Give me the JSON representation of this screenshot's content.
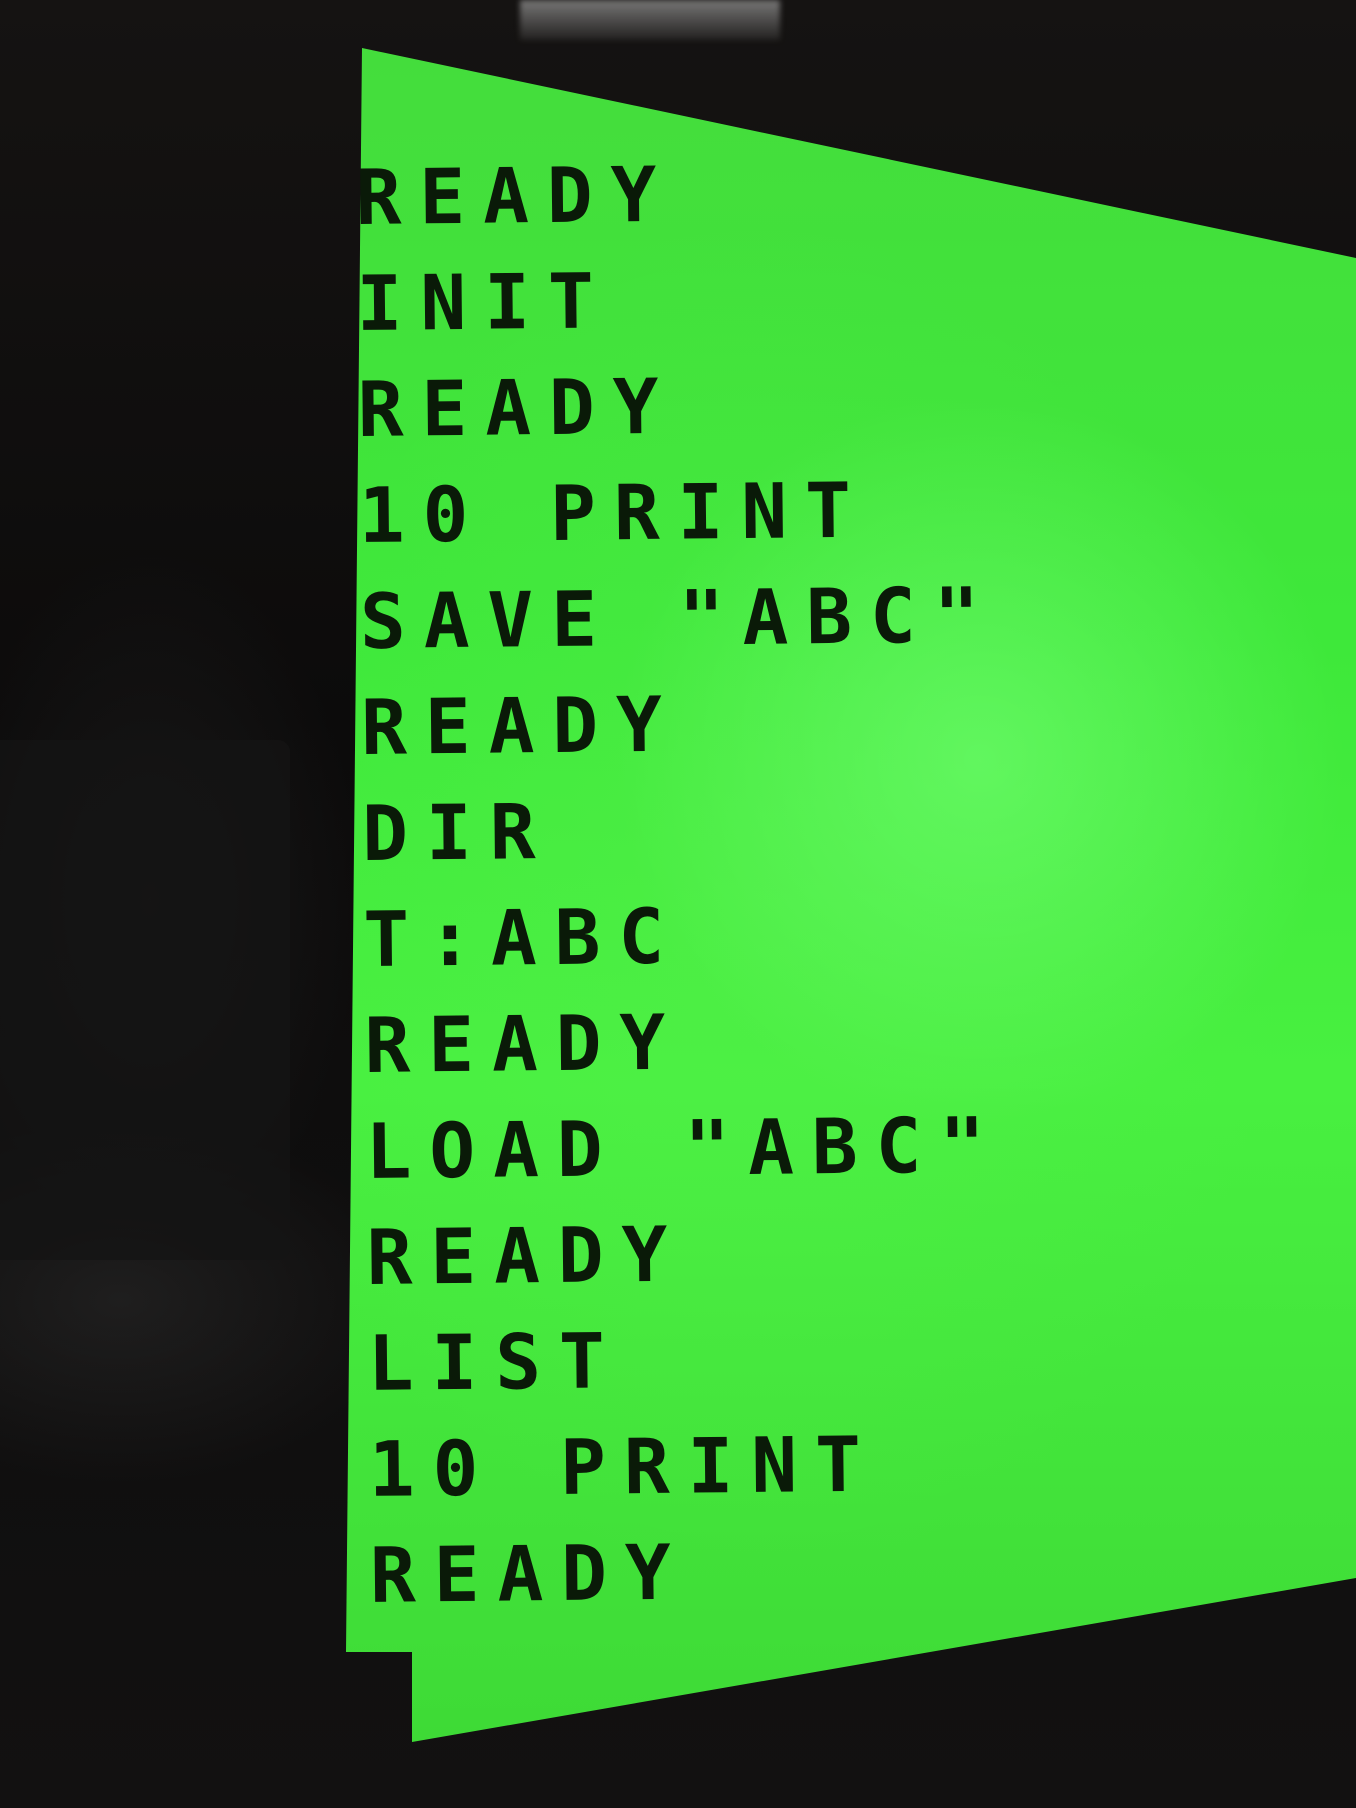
{
  "terminal": {
    "lines": [
      "READY",
      "INIT",
      "READY",
      "10 PRINT",
      "SAVE \"ABC\"",
      "READY",
      "DIR",
      "T:ABC",
      "READY",
      "LOAD \"ABC\"",
      "READY",
      "LIST",
      "10 PRINT",
      "READY"
    ]
  },
  "colors": {
    "screen": "#45e63c",
    "text": "#0a1a08",
    "bezel": "#0b0b0b"
  }
}
